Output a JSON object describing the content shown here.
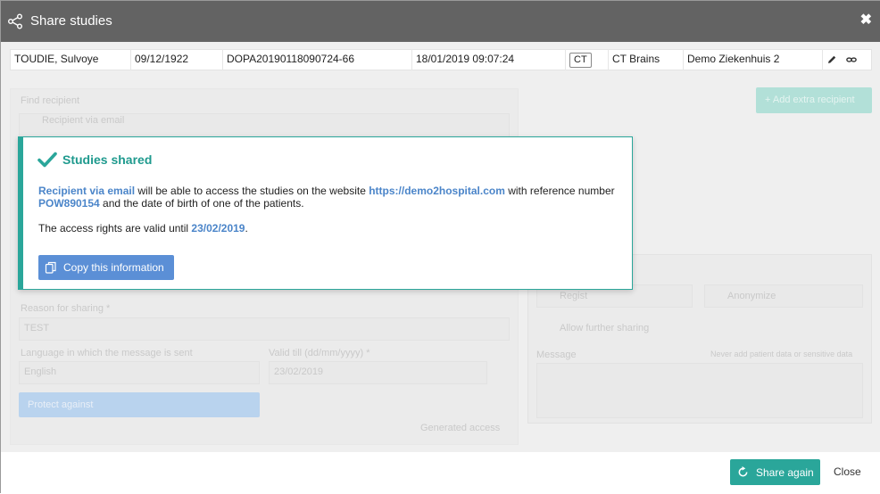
{
  "window": {
    "title": "Share studies"
  },
  "study": {
    "patient_name": "TOUDIE, Sulvoye",
    "birth_date": "09/12/1922",
    "accession": "DOPA20190118090724-66",
    "study_datetime": "18/01/2019 09:07:24",
    "modality": "CT",
    "description": "CT Brains",
    "institution": "Demo Ziekenhuis 2"
  },
  "background_form": {
    "find_recipient_label": "Find recipient",
    "recipient_placeholder": "Recipient via email",
    "add_recipient_label": "+ Add extra recipient",
    "reason_label": "Reason for sharing *",
    "reason_value": "TEST",
    "language_label": "Language in which the message is sent",
    "language_value": "English",
    "valid_label": "Valid till (dd/mm/yyyy) *",
    "valid_value": "23/02/2019",
    "protect_label": "Protect against",
    "generated_label": "Generated access",
    "option1": "Regist",
    "option2": "Anonymize",
    "allow_label": "Allow further sharing",
    "message_label": "Message",
    "message_hint": "Never add patient data or sensitive data"
  },
  "popover": {
    "heading": "Studies shared",
    "recipient": "Recipient via email",
    "text_a": " will be able to access the studies on the website ",
    "website": "https://demo2hospital.com",
    "text_b": " with reference number ",
    "reference": "POW890154",
    "text_c": " and the date of birth of one of the patients.",
    "valid_prefix": "The access rights are valid until ",
    "valid_date": "23/02/2019",
    "valid_suffix": ".",
    "copy_label": "Copy this information"
  },
  "footer": {
    "share_again_label": "Share again",
    "close_label": "Close"
  },
  "colors": {
    "title_bar": "#636363",
    "accent": "#2aa69a",
    "link": "#4b85c9",
    "primary_button": "#5b8fd6"
  },
  "icons": [
    "share-icon",
    "close-icon",
    "pencil-icon",
    "link-icon",
    "checkmark-icon",
    "copy-icon",
    "refresh-icon"
  ]
}
